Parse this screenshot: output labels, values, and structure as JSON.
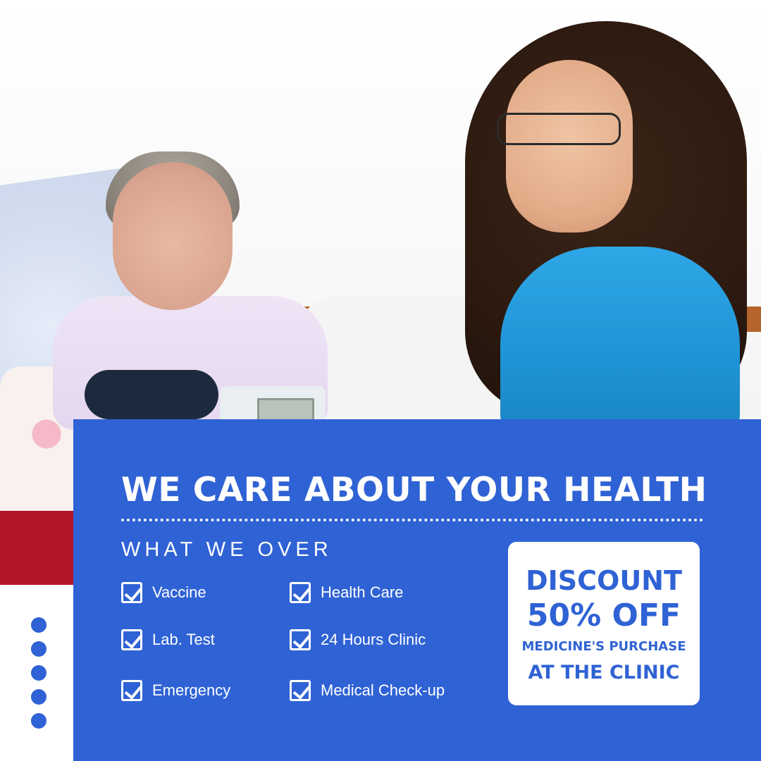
{
  "headline": "WE CARE ABOUT YOUR HEALTH",
  "subhead": "WHAT WE OVER",
  "services": {
    "col1": [
      "Vaccine",
      "Lab. Test",
      "Emergency"
    ],
    "col2": [
      "Health Care",
      "24 Hours Clinic",
      "Medical Check-up"
    ]
  },
  "promo": {
    "line1": "DISCOUNT",
    "line2": "50% OFF",
    "line3": "MEDICINE'S PURCHASE",
    "line4": "AT THE CLINIC"
  },
  "colors": {
    "panel_blue": "#2f62d4",
    "white": "#ffffff"
  },
  "icons": [
    "checkbox-check-icon",
    "dot-icon"
  ],
  "decorative_dots_count": 5
}
